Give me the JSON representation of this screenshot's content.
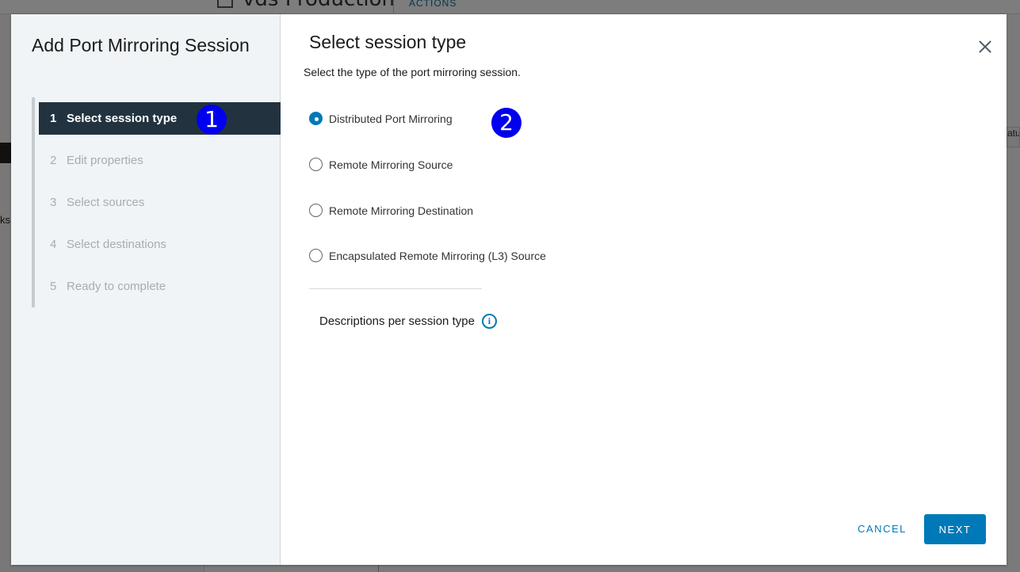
{
  "background": {
    "title": "vds Production",
    "actions_label": "ACTIONS",
    "left_cut_text": "ks",
    "right_cut_text": "atu"
  },
  "dialog": {
    "title": "Add Port Mirroring Session",
    "steps": [
      {
        "num": "1",
        "label": "Select session type",
        "state": "active"
      },
      {
        "num": "2",
        "label": "Edit properties",
        "state": "disabled"
      },
      {
        "num": "3",
        "label": "Select sources",
        "state": "disabled"
      },
      {
        "num": "4",
        "label": "Select destinations",
        "state": "disabled"
      },
      {
        "num": "5",
        "label": "Ready to complete",
        "state": "disabled"
      }
    ],
    "page": {
      "title": "Select session type",
      "subtitle": "Select the type of the port mirroring session.",
      "options": [
        {
          "label": "Distributed Port Mirroring",
          "checked": true
        },
        {
          "label": "Remote Mirroring Source",
          "checked": false
        },
        {
          "label": "Remote Mirroring Destination",
          "checked": false
        },
        {
          "label": "Encapsulated Remote Mirroring (L3) Source",
          "checked": false
        }
      ],
      "descriptions_label": "Descriptions per session type",
      "info_icon": "i"
    },
    "footer": {
      "cancel_label": "CANCEL",
      "next_label": "NEXT"
    }
  },
  "annotations": {
    "badge_1": "1",
    "badge_2": "2"
  },
  "colors": {
    "accent": "#0079b8",
    "active_step_bg": "#22333f",
    "annotation_badge": "#0000ee"
  }
}
